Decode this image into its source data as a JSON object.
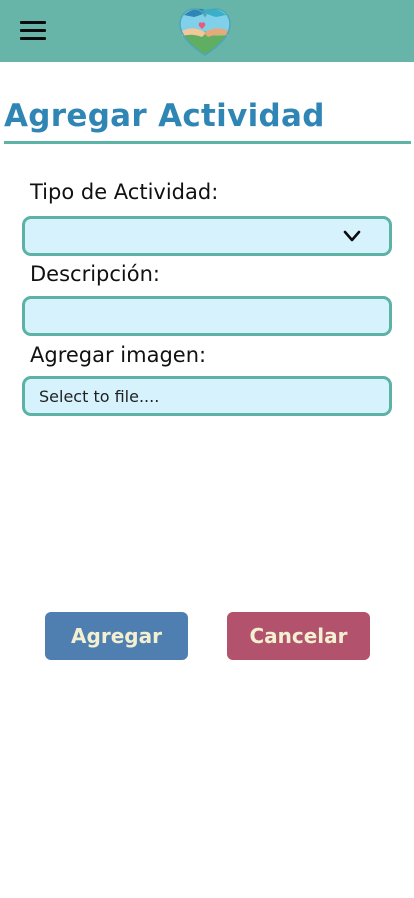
{
  "header": {
    "menu_icon": "hamburger-menu-icon",
    "logo_icon": "hands-heart-logo-icon"
  },
  "page": {
    "title": "Agregar Actividad"
  },
  "form": {
    "tipo_label": "Tipo de Actividad:",
    "tipo_value": "",
    "descripcion_label": "Descripción:",
    "descripcion_value": "",
    "imagen_label": "Agregar imagen:",
    "imagen_placeholder": "Select to file...."
  },
  "actions": {
    "add_label": "Agregar",
    "cancel_label": "Cancelar"
  },
  "colors": {
    "header_bg": "#66b5a8",
    "title": "#2f86b5",
    "field_bg": "#d6f3fd",
    "field_border": "#5cb2a4",
    "add_button": "#4f7fb0",
    "cancel_button": "#b2526d"
  }
}
